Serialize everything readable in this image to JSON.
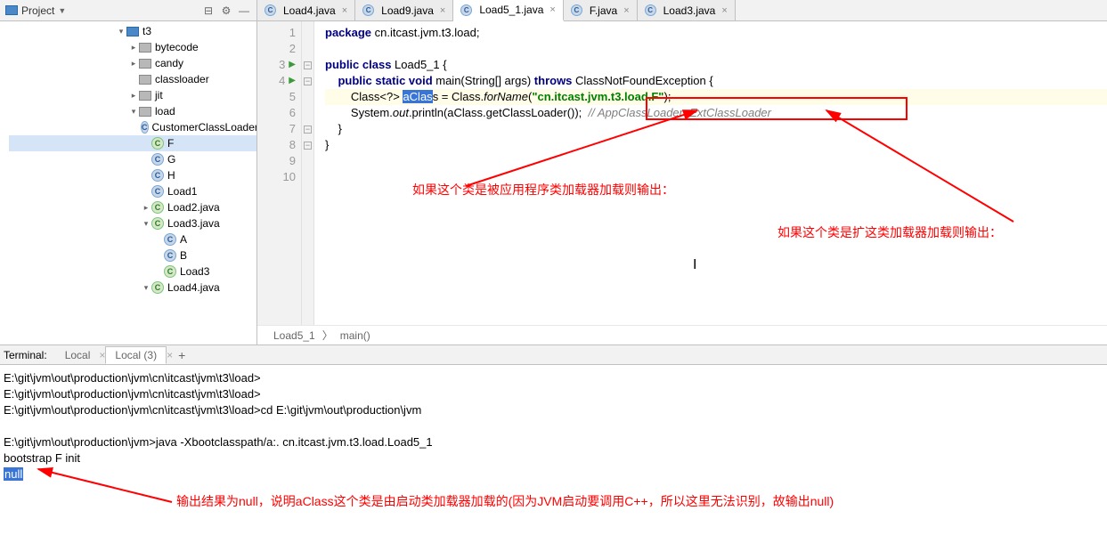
{
  "project": {
    "title": "Project",
    "tree": {
      "t3": "t3",
      "bytecode": "bytecode",
      "candy": "candy",
      "classloader": "classloader",
      "jit": "jit",
      "load": "load",
      "ccl": "CustomerClassLoader",
      "f": "F",
      "g": "G",
      "h": "H",
      "l1": "Load1",
      "l2": "Load2.java",
      "l3": "Load3.java",
      "a": "A",
      "b": "B",
      "l3c": "Load3",
      "l4": "Load4.java"
    }
  },
  "tabs": {
    "t1": "Load4.java",
    "t2": "Load9.java",
    "t3": "Load5_1.java",
    "t4": "F.java",
    "t5": "Load3.java"
  },
  "code": {
    "l1_pkg": "package",
    "l1_rest": " cn.itcast.jvm.t3.load;",
    "l3_kw": "public class",
    "l3_name": " Load5_1 {",
    "l4_kw1": "public static void",
    "l4_main": " main(String[] args) ",
    "l4_kw2": "throws",
    "l4_exc": " ClassNotFoundException {",
    "l5_pre": "        Class<?> ",
    "l5_sel": "aClas",
    "l5_mid": "s = Class.",
    "l5_for": "forName",
    "l5_paren": "(",
    "l5_str": "\"cn.itcast.jvm.t3.load.F\"",
    "l5_end": ");",
    "l6": "        System.",
    "l6_out": "out",
    "l6_mid": ".println(aClass.getClassLoader());",
    "l6_cmt": "  // AppClassLoader  ExtClassLoader",
    "l7": "    }",
    "l8": "}"
  },
  "breadcrumb": {
    "a": "Load5_1",
    "b": "main()"
  },
  "gutter": {
    "l1": "1",
    "l2": "2",
    "l3": "3",
    "l4": "4",
    "l5": "5",
    "l6": "6",
    "l7": "7",
    "l8": "8",
    "l9": "9",
    "l10": "10"
  },
  "annotations": {
    "a1": "如果这个类是被应用程序类加载器加载则输出：",
    "a2": "如果这个类是扩这类加载器加载则输出：",
    "a3": "输出结果为null，说明aClass这个类是由启动类加载器加载的(因为JVM启动要调用C++，所以这里无法识别，故输出null)"
  },
  "terminal": {
    "label": "Terminal:",
    "tab1": "Local",
    "tab2": "Local (3)",
    "l1": "E:\\git\\jvm\\out\\production\\jvm\\cn\\itcast\\jvm\\t3\\load>",
    "l2": "E:\\git\\jvm\\out\\production\\jvm\\cn\\itcast\\jvm\\t3\\load>",
    "l3": "E:\\git\\jvm\\out\\production\\jvm\\cn\\itcast\\jvm\\t3\\load>cd E:\\git\\jvm\\out\\production\\jvm",
    "l4": "E:\\git\\jvm\\out\\production\\jvm>java -Xbootclasspath/a:. cn.itcast.jvm.t3.load.Load5_1",
    "l5": "bootstrap F init",
    "l6": "null"
  }
}
